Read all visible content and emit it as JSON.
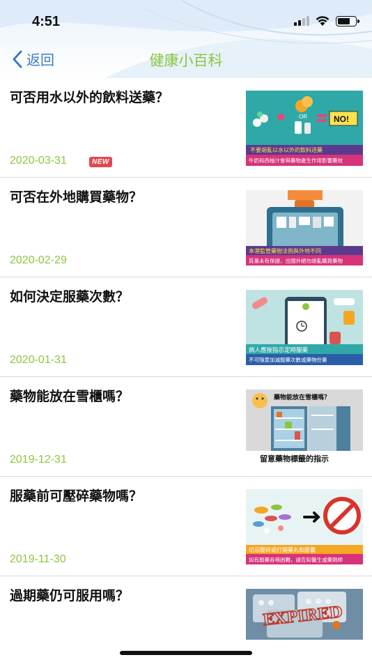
{
  "status_bar": {
    "time": "4:51"
  },
  "nav": {
    "back_label": "返回",
    "title": "健康小百科"
  },
  "articles": [
    {
      "title": "可否用水以外的飲料送藥？",
      "date": "2020-03-31",
      "badge": "NEW",
      "thumb": {
        "bg": "#2fa9a8",
        "caption1": "不要胡亂以水以外的飲料送藥",
        "caption2": "牛奶和西柚汁會與藥物產生作用影響藥效",
        "label_or": "OR",
        "label_no": "NO!"
      }
    },
    {
      "title": "可否在外地購買藥物？",
      "date": "2020-02-29",
      "thumb": {
        "bg": "#f2f2f2",
        "caption1": "本港監管藥物法例與外地不同",
        "caption2": "質量未有保證，出國外絕勿胡亂購買藥物"
      }
    },
    {
      "title": "如何決定服藥次數？",
      "date": "2020-01-31",
      "thumb": {
        "bg": "#bfe3e3",
        "caption1": "病人應按指示定時服藥",
        "caption2": "不可隨意加減服藥次數或藥物份量"
      }
    },
    {
      "title": "藥物能放在雪櫃嗎？",
      "date": "2019-12-31",
      "thumb": {
        "bg": "#d9d9d9",
        "caption1": "藥物能放在雪櫃嗎？",
        "caption2": "留意藥物標籤的指示"
      }
    },
    {
      "title": "服藥前可壓碎藥物嗎？",
      "date": "2019-11-30",
      "thumb": {
        "bg": "#2fa9a8",
        "caption1": "切忌壓碎或打開藥丸和膠囊",
        "caption2": "如有服藥吞嚥困難，請告知醫生或藥劑師"
      }
    },
    {
      "title": "過期藥仍可服用嗎？",
      "date": "",
      "thumb": {
        "bg": "#6f8ea6",
        "caption1": "EXPIRED"
      }
    }
  ]
}
